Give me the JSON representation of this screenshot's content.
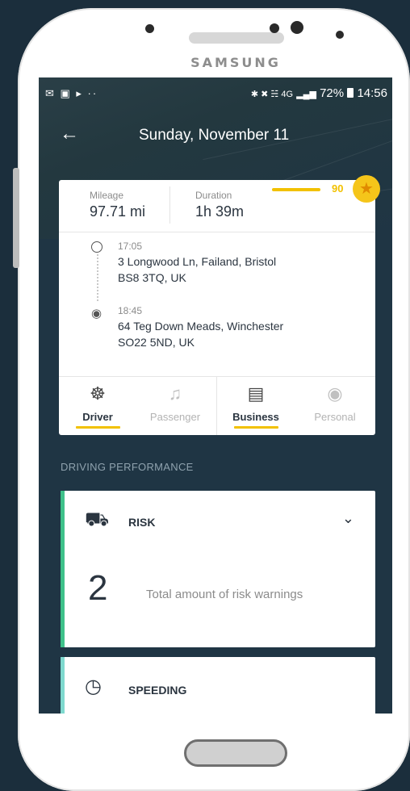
{
  "device": {
    "brand": "SAMSUNG"
  },
  "status_bar": {
    "left_icons": "✉ ▣ ▸ ··",
    "right_icons": "✱ ✖ ☵ 4G",
    "battery": "72%",
    "time": "14:56"
  },
  "header": {
    "back_icon": "←",
    "title": "Sunday, November 11"
  },
  "trip": {
    "mileage_label": "Mileage",
    "mileage_value": "97.71 mi",
    "duration_label": "Duration",
    "duration_value": "1h 39m",
    "score": "90",
    "score_icon": "star-icon",
    "start_time": "17:05",
    "start_address_line1": "3 Longwood Ln, Failand, Bristol",
    "start_address_line2": "BS8 3TQ, UK",
    "end_time": "18:45",
    "end_address_line1": "64 Teg Down Meads, Winchester",
    "end_address_line2": "SO22 5ND, UK"
  },
  "roles": {
    "driver": "Driver",
    "passenger": "Passenger",
    "business": "Business",
    "personal": "Personal"
  },
  "section_title": "DRIVING PERFORMANCE",
  "risk": {
    "label": "RISK",
    "count": "2",
    "description": "Total amount of risk warnings"
  },
  "speeding": {
    "label": "SPEEDING"
  },
  "colors": {
    "accent": "#f2c100",
    "risk_bar": "#3fc18a",
    "speeding_bar": "#7fd9cf",
    "background": "#1f3544"
  }
}
